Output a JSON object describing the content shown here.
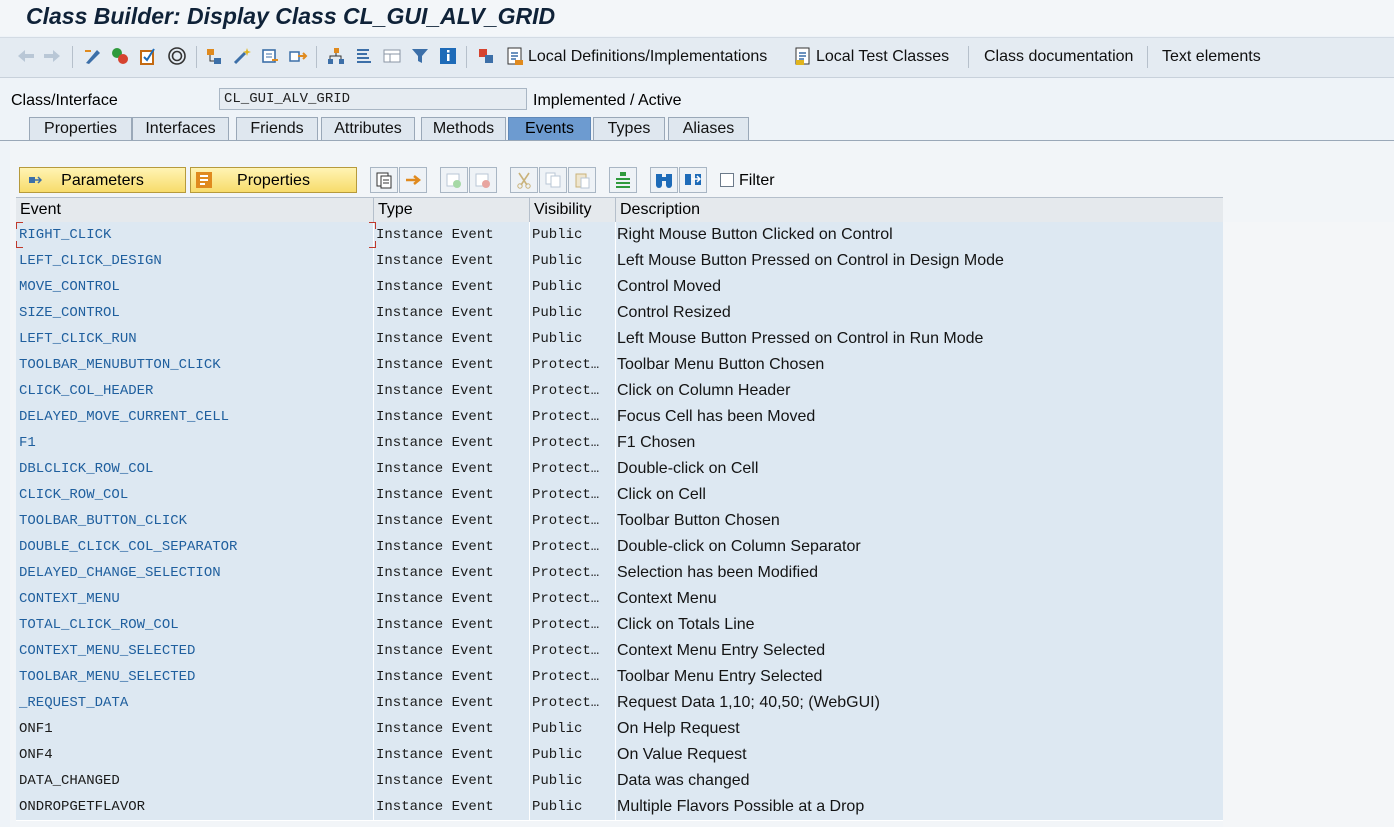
{
  "window": {
    "title": "Class Builder: Display Class CL_GUI_ALV_GRID"
  },
  "toolbar": {
    "local_defs_label": "Local Definitions/Implementations",
    "local_test_label": "Local Test Classes",
    "class_doc_label": "Class documentation",
    "text_elements_label": "Text elements"
  },
  "class_header": {
    "label": "Class/Interface",
    "value": "CL_GUI_ALV_GRID",
    "status": "Implemented / Active"
  },
  "tabs": [
    "Properties",
    "Interfaces",
    "Friends",
    "Attributes",
    "Methods",
    "Events",
    "Types",
    "Aliases"
  ],
  "active_tab": "Events",
  "events_toolbar": {
    "parameters_label": "Parameters",
    "properties_label": "Properties",
    "filter_label": "Filter",
    "filter_checked": false
  },
  "table": {
    "columns": [
      "Event",
      "Type",
      "Visibility",
      "Description"
    ],
    "rows": [
      {
        "event": "RIGHT_CLICK",
        "type": "Instance Event",
        "visibility": "Public",
        "description": "Right Mouse Button Clicked on Control"
      },
      {
        "event": "LEFT_CLICK_DESIGN",
        "type": "Instance Event",
        "visibility": "Public",
        "description": "Left Mouse Button Pressed on Control in Design Mode"
      },
      {
        "event": "MOVE_CONTROL",
        "type": "Instance Event",
        "visibility": "Public",
        "description": "Control Moved"
      },
      {
        "event": "SIZE_CONTROL",
        "type": "Instance Event",
        "visibility": "Public",
        "description": "Control Resized"
      },
      {
        "event": "LEFT_CLICK_RUN",
        "type": "Instance Event",
        "visibility": "Public",
        "description": "Left Mouse Button Pressed on Control in Run Mode"
      },
      {
        "event": "TOOLBAR_MENUBUTTON_CLICK",
        "type": "Instance Event",
        "visibility": "Protect…",
        "description": "Toolbar Menu Button Chosen"
      },
      {
        "event": "CLICK_COL_HEADER",
        "type": "Instance Event",
        "visibility": "Protect…",
        "description": "Click on Column Header"
      },
      {
        "event": "DELAYED_MOVE_CURRENT_CELL",
        "type": "Instance Event",
        "visibility": "Protect…",
        "description": "Focus Cell has been Moved"
      },
      {
        "event": "F1",
        "type": "Instance Event",
        "visibility": "Protect…",
        "description": "F1 Chosen"
      },
      {
        "event": "DBLCLICK_ROW_COL",
        "type": "Instance Event",
        "visibility": "Protect…",
        "description": "Double-click on Cell"
      },
      {
        "event": "CLICK_ROW_COL",
        "type": "Instance Event",
        "visibility": "Protect…",
        "description": "Click on Cell"
      },
      {
        "event": "TOOLBAR_BUTTON_CLICK",
        "type": "Instance Event",
        "visibility": "Protect…",
        "description": "Toolbar Button Chosen"
      },
      {
        "event": "DOUBLE_CLICK_COL_SEPARATOR",
        "type": "Instance Event",
        "visibility": "Protect…",
        "description": "Double-click on Column Separator"
      },
      {
        "event": "DELAYED_CHANGE_SELECTION",
        "type": "Instance Event",
        "visibility": "Protect…",
        "description": "Selection has been Modified"
      },
      {
        "event": "CONTEXT_MENU",
        "type": "Instance Event",
        "visibility": "Protect…",
        "description": "Context Menu"
      },
      {
        "event": "TOTAL_CLICK_ROW_COL",
        "type": "Instance Event",
        "visibility": "Protect…",
        "description": "Click on Totals Line"
      },
      {
        "event": "CONTEXT_MENU_SELECTED",
        "type": "Instance Event",
        "visibility": "Protect…",
        "description": "Context Menu Entry Selected"
      },
      {
        "event": "TOOLBAR_MENU_SELECTED",
        "type": "Instance Event",
        "visibility": "Protect…",
        "description": "Toolbar Menu Entry Selected"
      },
      {
        "event": "_REQUEST_DATA",
        "type": "Instance Event",
        "visibility": "Protect…",
        "description": "Request Data 1,10; 40,50; (WebGUI)"
      },
      {
        "event": "ONF1",
        "type": "Instance Event",
        "visibility": "Public",
        "description": "On Help Request"
      },
      {
        "event": "ONF4",
        "type": "Instance Event",
        "visibility": "Public",
        "description": "On Value Request"
      },
      {
        "event": "DATA_CHANGED",
        "type": "Instance Event",
        "visibility": "Public",
        "description": "Data was changed"
      },
      {
        "event": "ONDROPGETFLAVOR",
        "type": "Instance Event",
        "visibility": "Public",
        "description": "Multiple Flavors Possible at a Drop"
      }
    ]
  },
  "colors": {
    "active_tab": "#6d9bd0",
    "link_event": "#1f5f9e",
    "row_bg": "#dde8f2",
    "button_yellow": "#f7dc6b"
  }
}
